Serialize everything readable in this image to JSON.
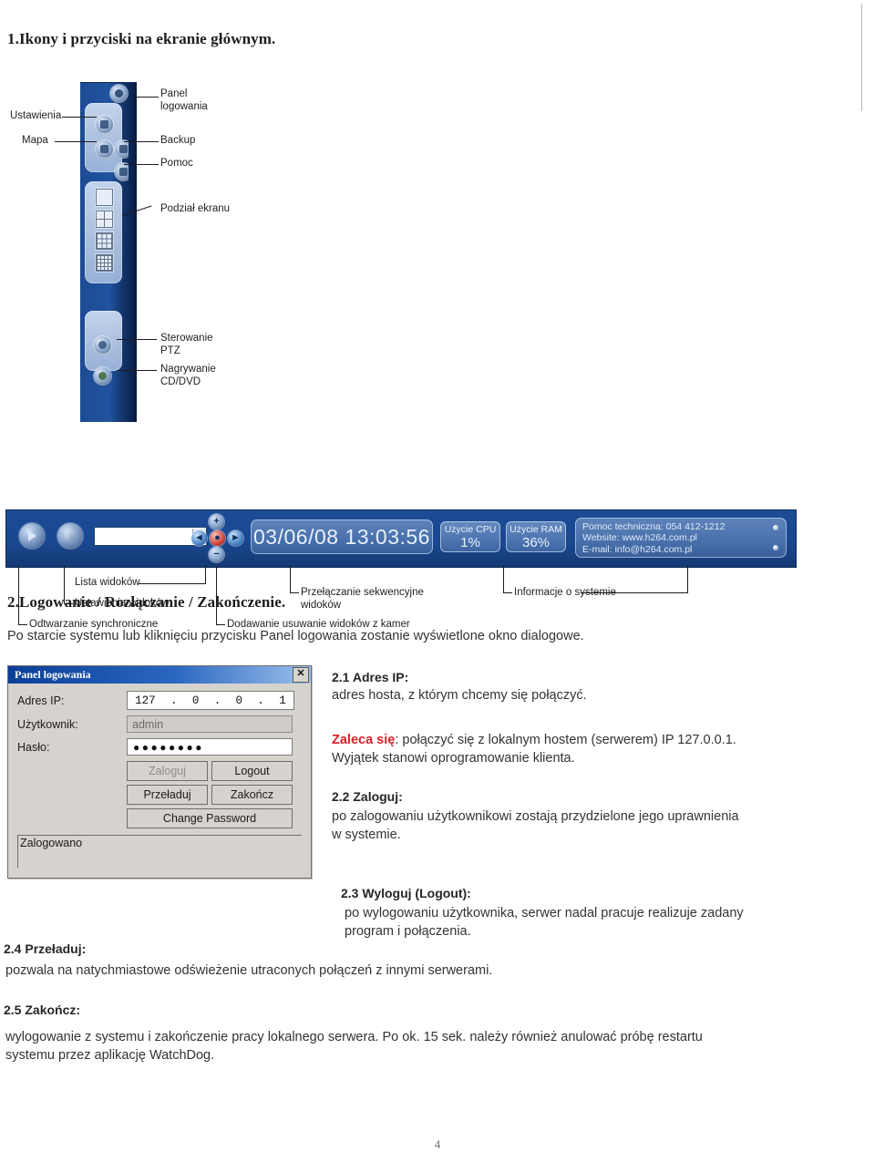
{
  "document": {
    "page_number": "4"
  },
  "section1": {
    "heading": "1.Ikony i przyciski na ekranie głównym.",
    "sidebar_callouts": {
      "panel_logowania": "Panel\nlogowania",
      "ustawienia": "Ustawienia",
      "mapa": "Mapa",
      "backup": "Backup",
      "pomoc": "Pomoc",
      "podzial_ekranu": "Podział ekranu",
      "sterowanie_ptz": "Sterowanie\nPTZ",
      "nagrywanie": "Nagrywanie\nCD/DVD"
    },
    "statusbar": {
      "clock": "03/06/08 13:03:56",
      "cpu_label": "Użycie CPU",
      "cpu_value": "1%",
      "ram_label": "Użycie RAM",
      "ram_value": "36%",
      "support_line1": "Pomoc techniczna: 054 412-1212",
      "support_line2": "Website: www.h264.com.pl",
      "support_line3": "E-mail: info@h264.com.pl",
      "combo_arrow": "▼",
      "plus": "+",
      "minus": "−",
      "prev": "◄",
      "rec": "●",
      "next": "►"
    },
    "bar_callouts": {
      "odtwarzanie": "Odtwarzanie synchroniczne",
      "ustawienia_widokow": "Ustawienia widoków",
      "lista_widokow": "Lista widoków",
      "dodawanie": "Dodawanie usuwanie widoków z kamer",
      "przelaczanie": "Przełączanie sekwencyjne\nwidoków",
      "informacje": "Informacje o systemie"
    }
  },
  "section2": {
    "heading": "2.Logowanie / Rozłączanie / Zakończenie.",
    "intro": "Po starcie systemu lub kliknięciu przycisku Panel logowania zostanie wyświetlone okno dialogowe.",
    "dialog": {
      "title": "Panel logowania",
      "close_label": "✕",
      "ip_label": "Adres IP:",
      "ip_octets": [
        "127",
        ".",
        "0",
        ".",
        "0",
        ".",
        "1"
      ],
      "user_label": "Użytkownik:",
      "user_value": "admin",
      "pass_label": "Hasło:",
      "pass_value": "●●●●●●●●",
      "btn_login": "Zaloguj",
      "btn_logout": "Logout",
      "btn_reload": "Przeładuj",
      "btn_quit": "Zakończ",
      "btn_change_password": "Change Password",
      "status": "Zalogowano"
    },
    "items": {
      "i21_head": "2.1 Adres IP:",
      "i21_body": "adres hosta, z którym chcemy się połączyć.",
      "i21_note_strong": "Zaleca się",
      "i21_note_rest": ": połączyć się z lokalnym hostem (serwerem) IP 127.0.0.1.",
      "i21_note_line2": "Wyjątek stanowi oprogramowanie klienta.",
      "i22_head": "2.2 Zaloguj:",
      "i22_body_line1": "po zalogowaniu użytkownikowi zostają przydzielone jego uprawnienia",
      "i22_body_line2": "w systemie.",
      "i23_head": "2.3 Wyloguj (Logout):",
      "i23_body_line1": "po wylogowaniu użytkownika, serwer nadal pracuje realizuje zadany",
      "i23_body_line2": "program i połączenia.",
      "i24_head": "2.4 Przeładuj:",
      "i24_body": "pozwala na natychmiastowe odświeżenie utraconych połączeń z innymi serwerami.",
      "i25_head": "2.5 Zakończ:",
      "i25_body_line1": "wylogowanie z systemu i zakończenie pracy lokalnego serwera. Po ok. 15 sek. należy również anulować próbę restartu",
      "i25_body_line2": "systemu przez aplikację WatchDog."
    }
  }
}
